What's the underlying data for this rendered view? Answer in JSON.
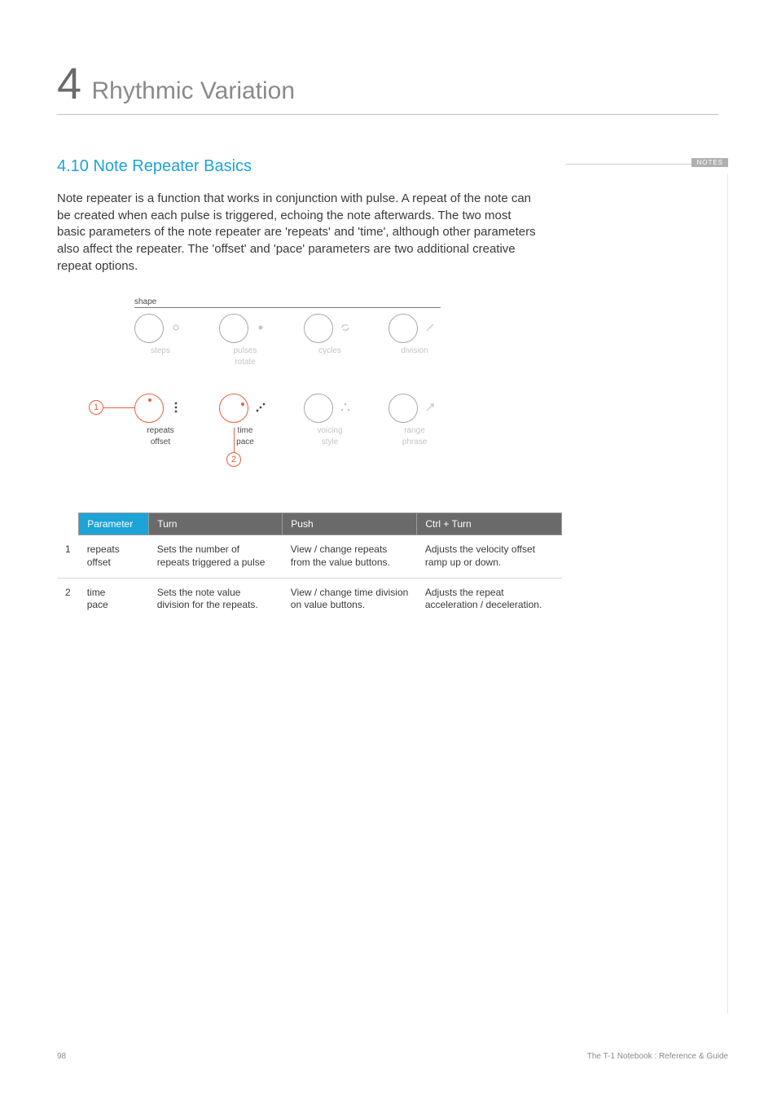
{
  "chapter": {
    "number": "4",
    "title": "Rhythmic Variation"
  },
  "section": {
    "heading": "4.10 Note Repeater Basics"
  },
  "body": "Note repeater is a function that works in conjunction with pulse. A repeat of the note can be created when each pulse is triggered, echoing the note afterwards. The two most basic parameters of the note repeater are 'repeats' and 'time', although other parameters also affect the repeater. The 'offset' and 'pace' parameters are two additional creative repeat options.",
  "notes_label": "NOTES",
  "panel": {
    "top_label": "shape",
    "row1": [
      {
        "label_top": "steps",
        "label_bottom": "",
        "icon": "circle-small",
        "dim": true
      },
      {
        "label_top": "pulses",
        "label_bottom": "rotate",
        "icon": "dot",
        "dim": true
      },
      {
        "label_top": "cycles",
        "label_bottom": "",
        "icon": "refresh",
        "dim": true
      },
      {
        "label_top": "division",
        "label_bottom": "",
        "icon": "slash",
        "dim": true
      }
    ],
    "row2": [
      {
        "label_top": "repeats",
        "label_bottom": "offset",
        "icon": "three-dots-v",
        "active": true
      },
      {
        "label_top": "time",
        "label_bottom": "pace",
        "icon": "three-dots-diag",
        "active": true
      },
      {
        "label_top": "voicing",
        "label_bottom": "style",
        "icon": "three-dots-tri",
        "dim": true
      },
      {
        "label_top": "range",
        "label_bottom": "phrase",
        "icon": "arrow-diag",
        "dim": true
      }
    ],
    "callouts": {
      "c1": "1",
      "c2": "2"
    }
  },
  "table": {
    "headers": {
      "parameter": "Parameter",
      "turn": "Turn",
      "push": "Push",
      "ctrl_turn": "Ctrl + Turn"
    },
    "rows": [
      {
        "num": "1",
        "param_top": "repeats",
        "param_bottom": "offset",
        "turn": "Sets the number of repeats triggered a pulse",
        "push": "View / change repeats from the value buttons.",
        "ctrl": "Adjusts the velocity offset ramp up or down."
      },
      {
        "num": "2",
        "param_top": "time",
        "param_bottom": "pace",
        "turn": "Sets the note value division for the repeats.",
        "push": "View / change time division on value buttons.",
        "ctrl": "Adjusts the repeat acceleration / deceleration."
      }
    ]
  },
  "footer": {
    "page": "98",
    "title": "The T-1 Notebook : Reference & Guide"
  }
}
